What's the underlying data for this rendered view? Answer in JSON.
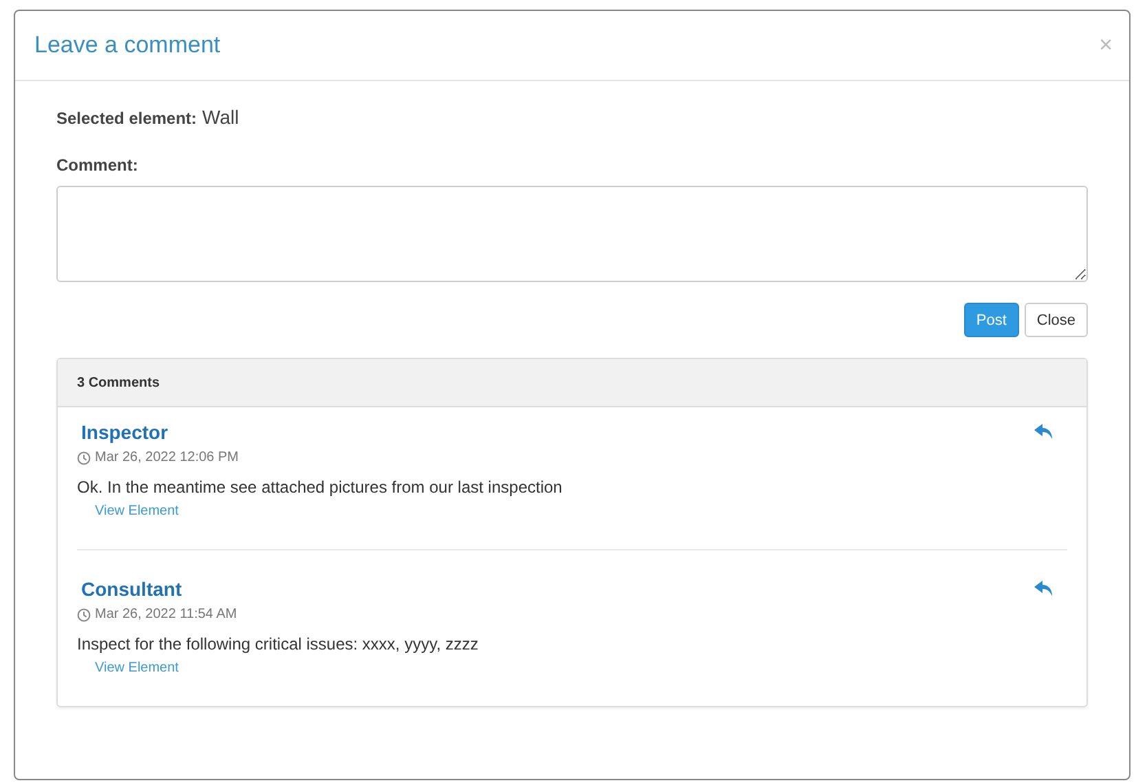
{
  "dialog": {
    "title": "Leave a comment",
    "close_icon": "×"
  },
  "selected_element": {
    "label": "Selected element:",
    "value": "Wall"
  },
  "comment_field": {
    "label": "Comment:"
  },
  "buttons": [
    {
      "label": "Post",
      "kind": "primary"
    },
    {
      "label": "Close",
      "kind": "default"
    }
  ],
  "comments_panel": {
    "heading": "3 Comments",
    "comments": [
      {
        "author": "Inspector",
        "time": "Mar 26, 2022 12:06 PM",
        "text": "Ok. In the meantime see attached pictures from our last inspection",
        "link": "View Element"
      },
      {
        "author": "Consultant",
        "time": "Mar 26, 2022 11:54 AM",
        "text": "Inspect for the following critical issues: xxxx, yyyy, zzzz",
        "link": "View Element"
      }
    ]
  }
}
